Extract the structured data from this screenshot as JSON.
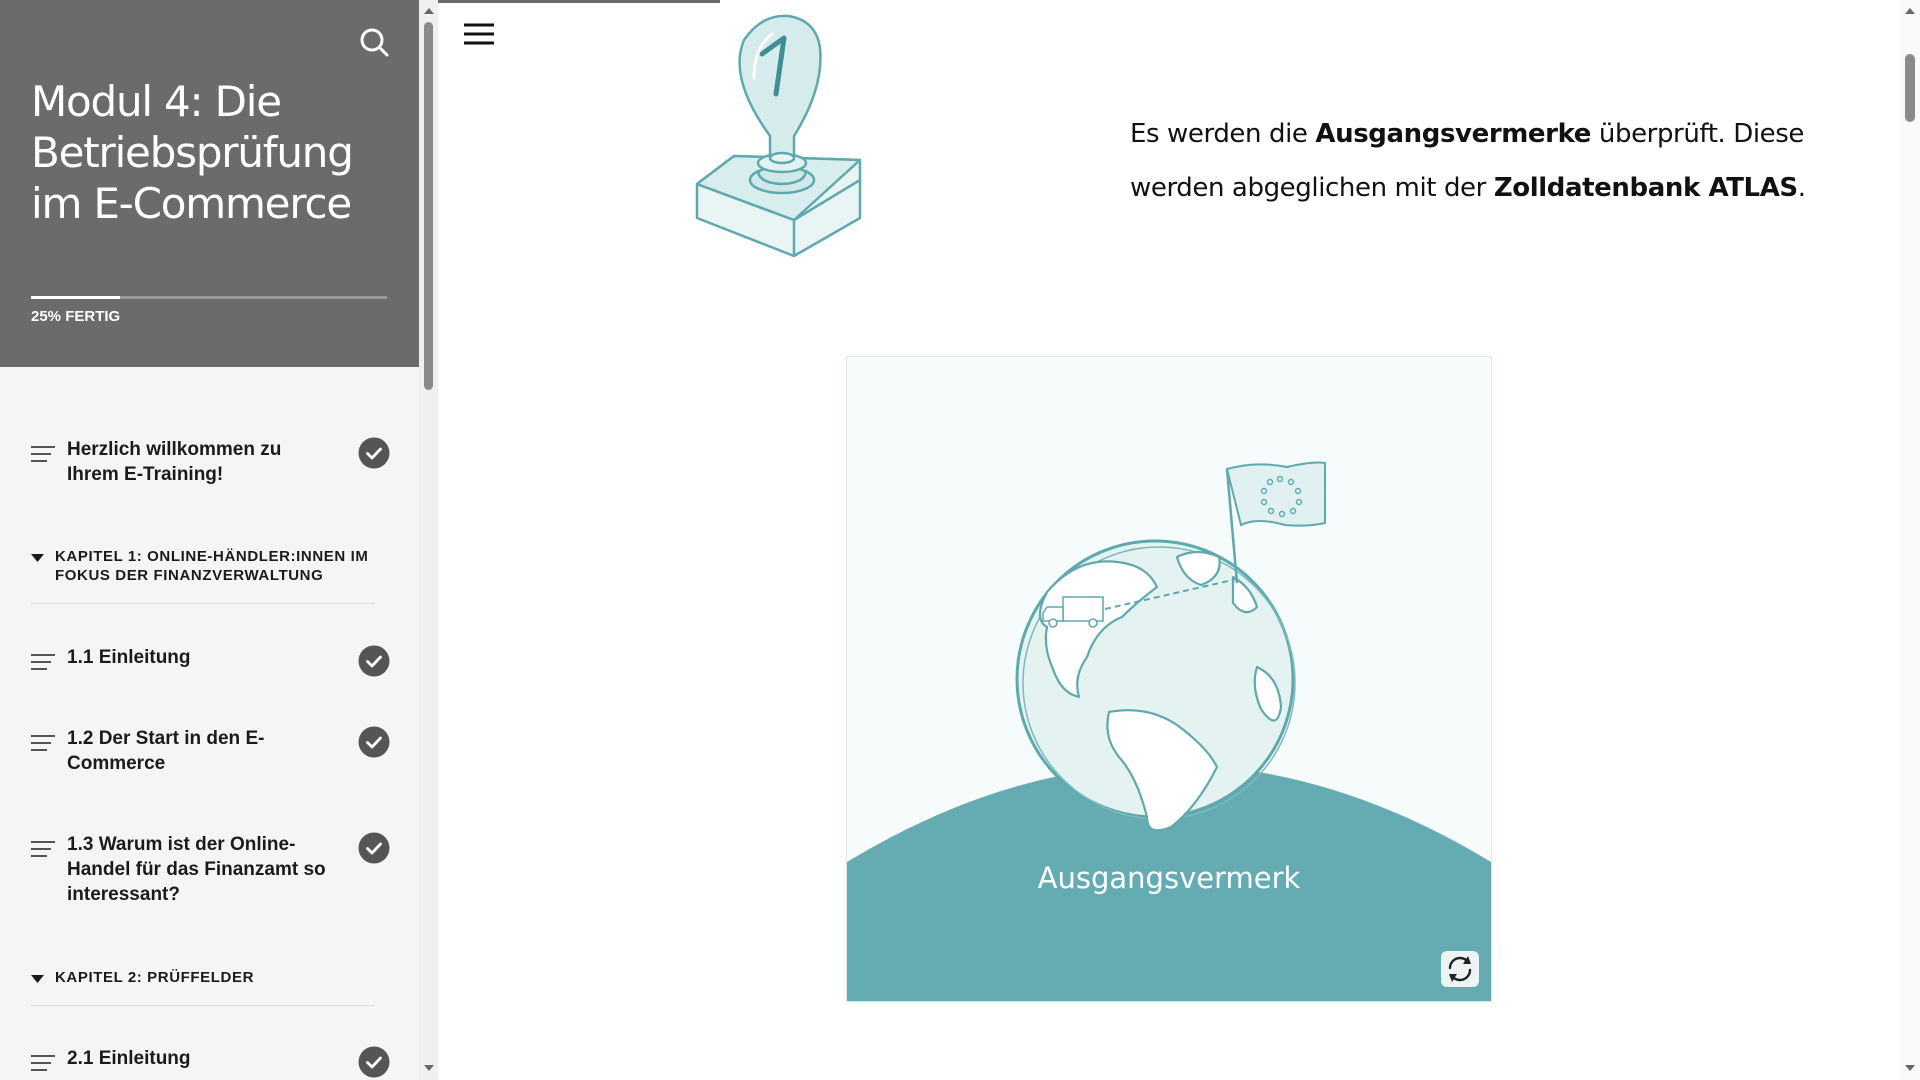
{
  "sidebar": {
    "course_title": "Modul 4: Die Betriebsprüfung im E-Commerce",
    "progress": {
      "fraction": 0.25,
      "label": "25% FERTIG"
    },
    "search_icon": "search-icon",
    "items": [
      {
        "kind": "lesson",
        "label": "Herzlich willkommen zu Ihrem E-Training!",
        "completed": true
      },
      {
        "kind": "chapter",
        "label": "KAPITEL 1: ONLINE-HÄNDLER:INNEN IM FOKUS DER FINANZVERWALTUNG",
        "expanded": true
      },
      {
        "kind": "lesson",
        "label": "1.1 Einleitung",
        "completed": true
      },
      {
        "kind": "lesson",
        "label": "1.2 Der Start in den E-Commerce",
        "completed": true
      },
      {
        "kind": "lesson",
        "label": "1.3 Warum ist der Online-Handel für das Finanzamt so interessant?",
        "completed": true
      },
      {
        "kind": "chapter",
        "label": "KAPITEL 2: PRÜFFELDER",
        "expanded": true
      },
      {
        "kind": "lesson",
        "label": "2.1 Einleitung",
        "completed": true
      }
    ]
  },
  "main": {
    "menu_icon": "hamburger-menu-icon",
    "info_text": {
      "part1": "Es werden die ",
      "bold1": "Ausgangsvermerke",
      "part2": " überprüft. Diese werden abgeglichen mit der ",
      "bold2": "Zolldatenbank ATLAS",
      "part3": "."
    },
    "flashcard": {
      "caption": "Ausgangsvermerk",
      "flip_icon": "flip-refresh-icon"
    }
  },
  "colors": {
    "sidebar_header": "#6b6b6b",
    "accent_teal": "#64acb1",
    "check_circle": "#555555"
  }
}
